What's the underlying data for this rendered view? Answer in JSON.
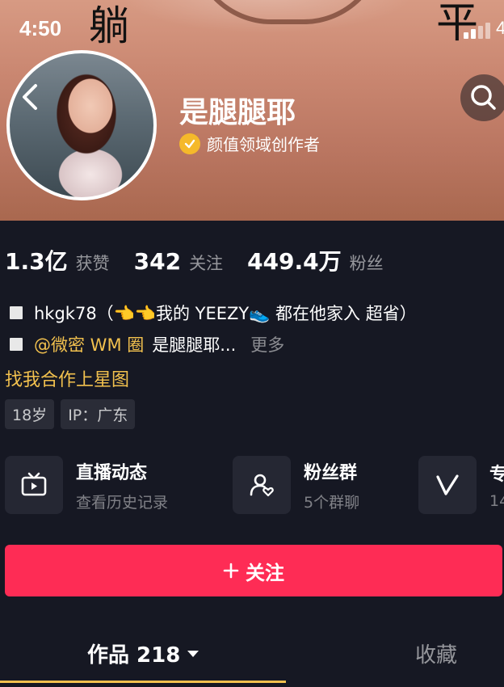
{
  "status_bar": {
    "time": "4:50",
    "edge_text": "4"
  },
  "cover": {
    "glyph_left": "躺",
    "glyph_right": "平"
  },
  "profile": {
    "name": "是腿腿耶",
    "verification": "颜值领域创作者"
  },
  "stats": [
    {
      "value": "1.3亿",
      "label": "获赞"
    },
    {
      "value": "342",
      "label": "关注"
    },
    {
      "value": "449.4万",
      "label": "粉丝"
    }
  ],
  "bio": {
    "line1": "hkgk78（👈👈我的 YEEZY👟 都在他家入 超省）",
    "line2_mention": "@微密 WM 圈",
    "line2_text": "是腿腿耶...",
    "more": "更多",
    "star_link": "找我合作上星图"
  },
  "tags": [
    "18岁",
    "IP：广东"
  ],
  "cards": [
    {
      "title": "直播动态",
      "sub": "查看历史记录",
      "icon": "tv-icon"
    },
    {
      "title": "粉丝群",
      "sub": "5个群聊",
      "icon": "fan-group-icon"
    },
    {
      "title": "专",
      "sub": "14",
      "icon": "v-logo-icon"
    }
  ],
  "follow_button": {
    "label": "关注"
  },
  "tabs": {
    "works": "作品 218",
    "favorites": "收藏"
  },
  "colors": {
    "accent": "#fe2c55",
    "highlight": "#f2c14e",
    "background": "#161823",
    "card": "#252733"
  }
}
